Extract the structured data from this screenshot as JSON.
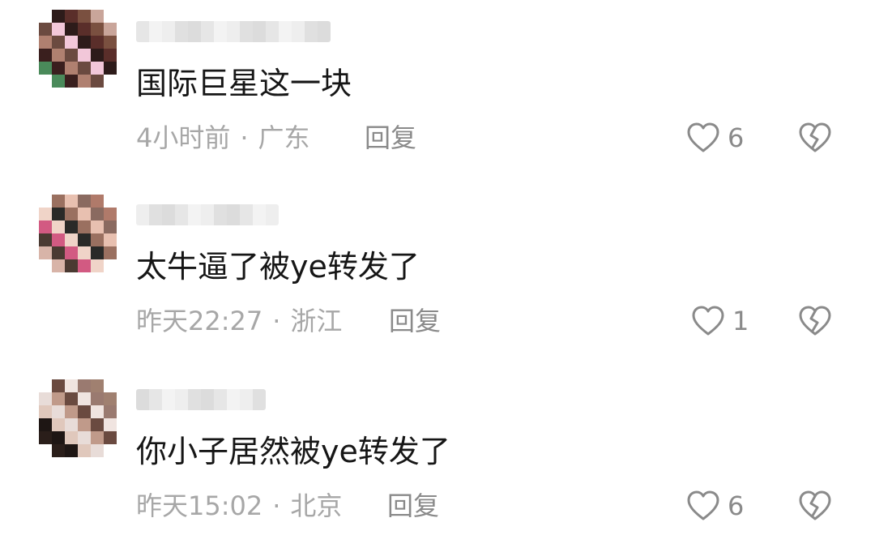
{
  "comments": [
    {
      "username": "",
      "text": "国际巨星这一块",
      "time": "4小时前",
      "separator": "·",
      "location": "广东",
      "reply_label": "回复",
      "likes": "6",
      "avatar_colors": [
        "#f2c7d9",
        "#a56a7a",
        "#5a2e2a",
        "#3a1f1e",
        "#c9a59a",
        "#6b4a40",
        "#d47fa6",
        "#2d1b1a",
        "#4a8a5a",
        "#7a5040",
        "#b08070",
        "#e8d0c8"
      ]
    },
    {
      "username": "",
      "text": "太牛逼了被ye转发了",
      "time": "昨天22:27",
      "separator": "·",
      "location": "浙江",
      "reply_label": "回复",
      "likes": "1",
      "avatar_colors": [
        "#8a6a60",
        "#d25a82",
        "#6a4a42",
        "#2a2a28",
        "#c8a090",
        "#e8c0b0",
        "#4a3a32",
        "#b07a6a",
        "#f0d4c8",
        "#3a2e2a",
        "#9a7060",
        "#d8b4a8"
      ]
    },
    {
      "username": "",
      "text": "你小子居然被ye转发了",
      "time": "昨天15:02",
      "separator": "·",
      "location": "北京",
      "reply_label": "回复",
      "likes": "6",
      "avatar_colors": [
        "#d0c8c8",
        "#6a4a40",
        "#2a1e1a",
        "#9a7a70",
        "#e0c8bc",
        "#3a2a24",
        "#c09a8a",
        "#5a4038",
        "#f0e4e0",
        "#1e1614",
        "#a08070",
        "#e8dcd8"
      ]
    }
  ],
  "colors": {
    "text": "#161616",
    "meta": "#a7a7a7",
    "icon": "#8a8a8a",
    "background": "#ffffff"
  }
}
